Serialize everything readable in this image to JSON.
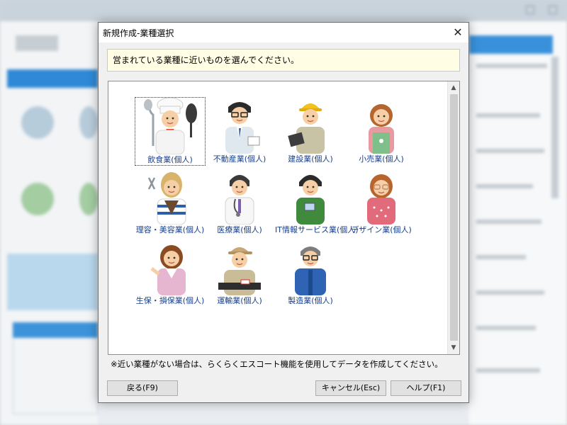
{
  "dialog": {
    "title": "新規作成-業種選択",
    "close_glyph": "✕",
    "instruction": "営まれている業種に近いものを選んでください。",
    "footnote": "※近い業種がない場合は、らくらくエスコート機能を使用してデータを作成してください。",
    "scroll_up_glyph": "▲",
    "scroll_down_glyph": "▼",
    "industries": [
      {
        "label": "飲食業(個人)",
        "icon": "chef-icon",
        "selected": true
      },
      {
        "label": "不動産業(個人)",
        "icon": "realtor-icon"
      },
      {
        "label": "建設業(個人)",
        "icon": "construction-worker-icon"
      },
      {
        "label": "小売業(個人)",
        "icon": "shopkeeper-icon"
      },
      {
        "label": "理容・美容業(個人)",
        "icon": "hairdresser-icon"
      },
      {
        "label": "医療業(個人)",
        "icon": "doctor-icon"
      },
      {
        "label": "IT情報サービス業(個人)",
        "icon": "it-engineer-icon"
      },
      {
        "label": "デザイン業(個人)",
        "icon": "designer-icon"
      },
      {
        "label": "生保・損保業(個人)",
        "icon": "insurance-agent-icon"
      },
      {
        "label": "運輸業(個人)",
        "icon": "driver-icon"
      },
      {
        "label": "製造業(個人)",
        "icon": "factory-worker-icon"
      }
    ],
    "buttons": {
      "back": "戻る(F9)",
      "cancel": "キャンセル(Esc)",
      "help": "ヘルプ(F1)"
    }
  }
}
